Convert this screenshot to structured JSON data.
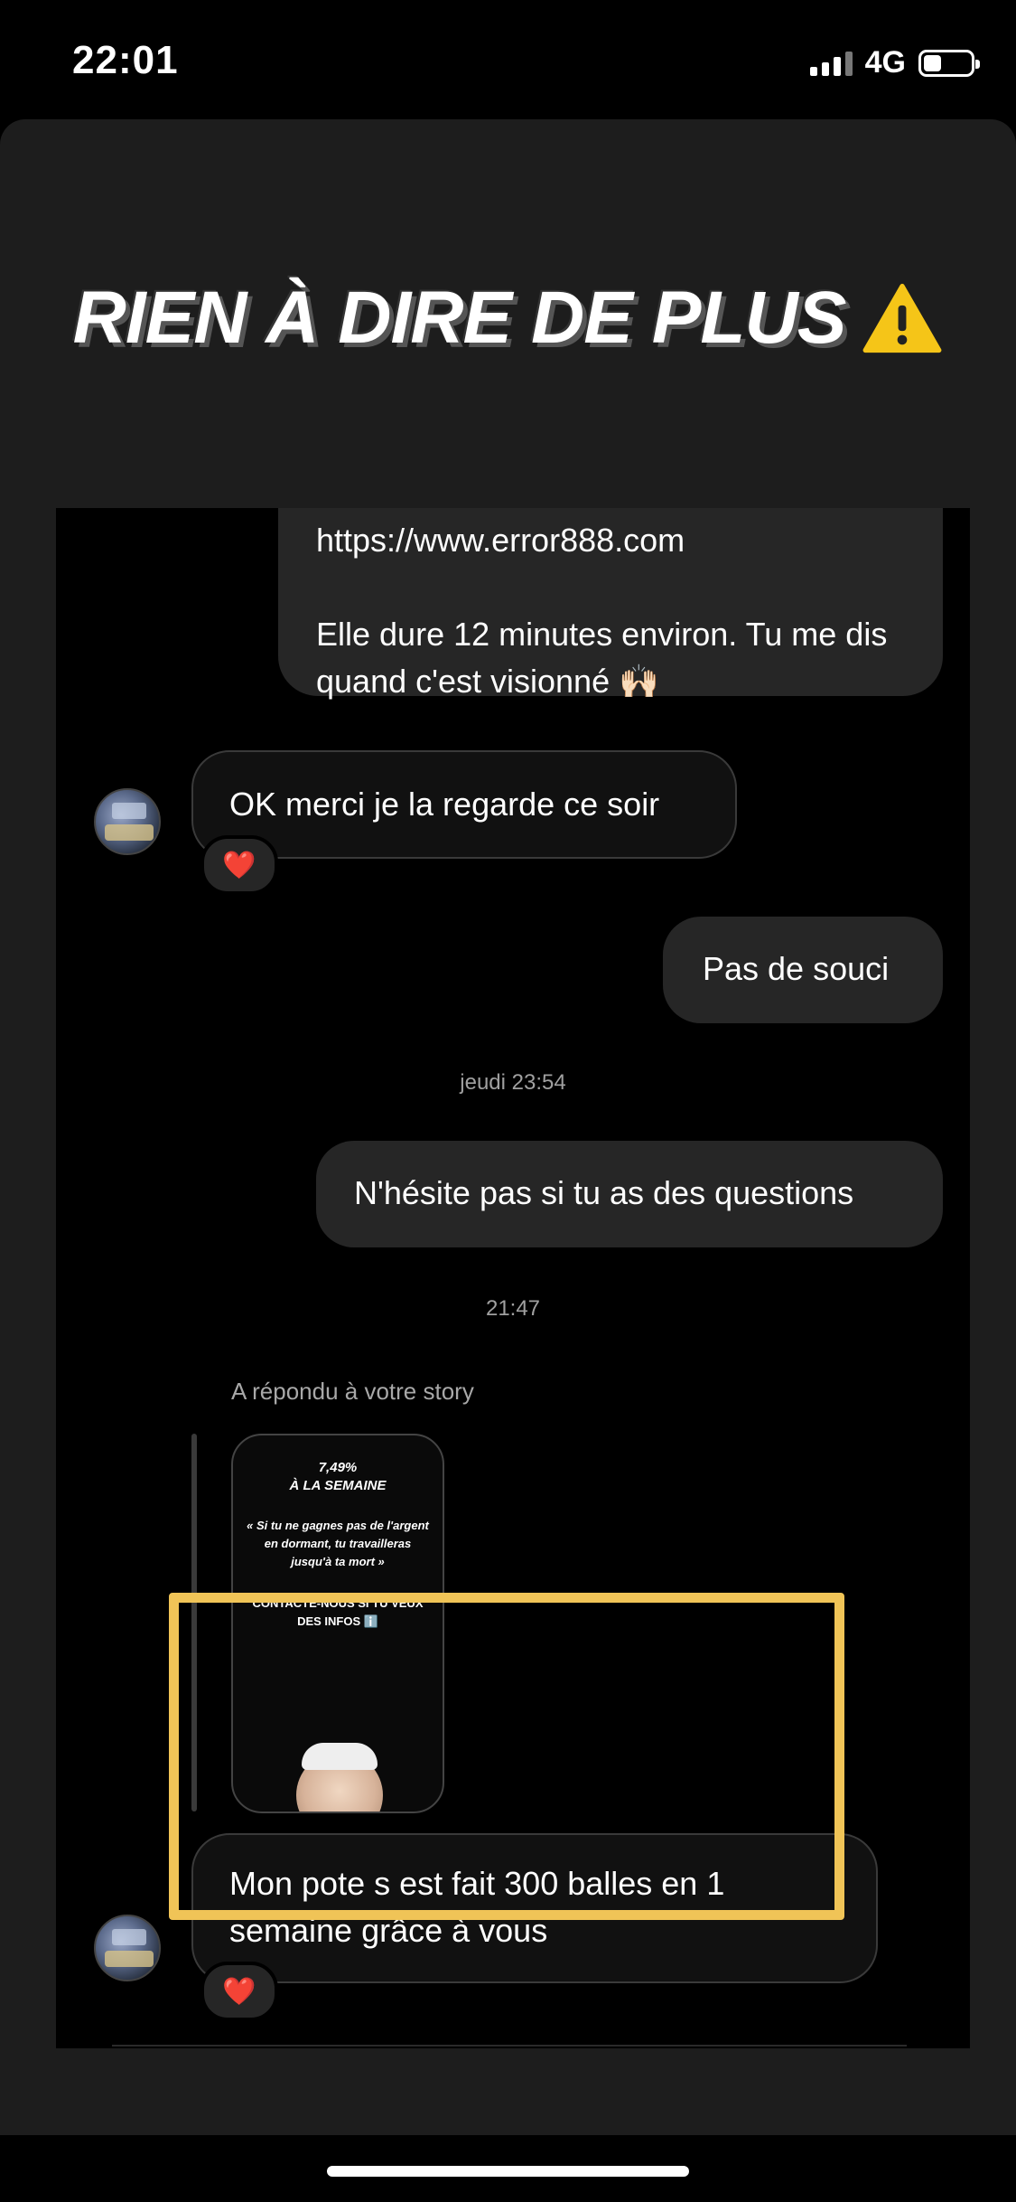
{
  "status_bar": {
    "time": "22:01",
    "network": "4G",
    "battery_level": 0.3
  },
  "banner": {
    "title": "RIEN À DIRE DE PLUS",
    "icon": "warning-icon"
  },
  "messages": {
    "m1_link": "https://www.error888.com",
    "m1_body": "Elle dure 12 minutes environ. Tu me dis quand c'est visionné 🙌🏻",
    "m2": "OK merci je la regarde ce soir",
    "m2_reaction": "❤️",
    "m3": "Pas de souci",
    "ts1": "jeudi 23:54",
    "m4": "N'hésite pas si tu as des questions",
    "ts2": "21:47",
    "reply_label": "A répondu à votre story",
    "story": {
      "percent": "7,49%",
      "week": "À LA SEMAINE",
      "quote": "« Si tu ne gagnes pas de l'argent en dormant, tu travailleras jusqu'à ta mort »",
      "cta": "CONTACTE-NOUS SI TU VEUX DES INFOS ℹ️"
    },
    "m5": "Mon pote s est fait 300 balles en 1 semaine grâce à vous",
    "m5_reaction": "❤️"
  },
  "colors": {
    "highlight": "#f0c457",
    "bubble": "#262626",
    "background": "#000000"
  }
}
